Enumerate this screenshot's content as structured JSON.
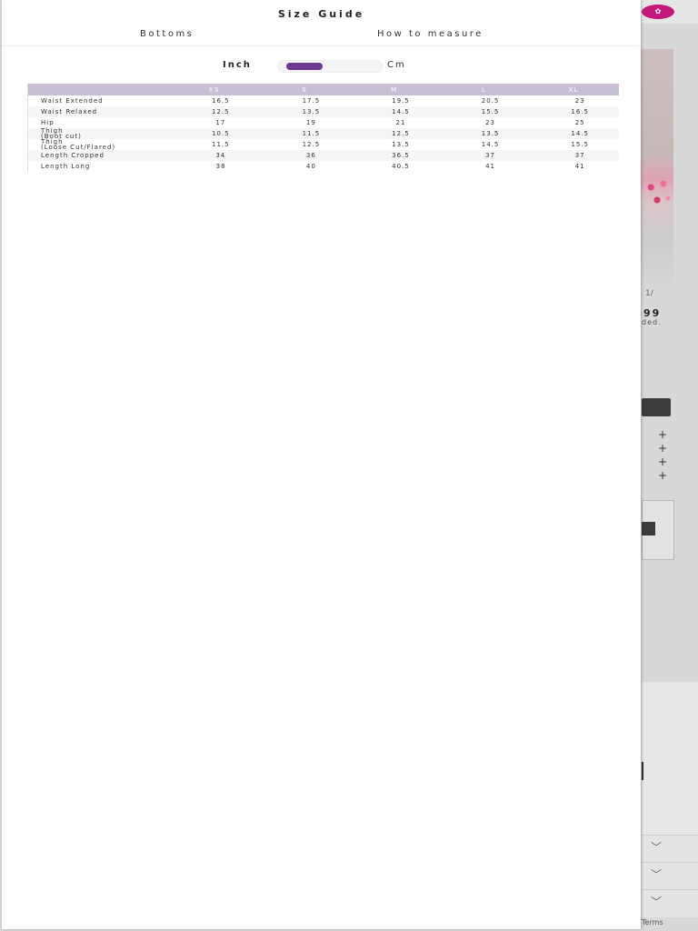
{
  "background": {
    "logo_text": "✿",
    "pager": "1/",
    "price": "99",
    "note": "ded.",
    "terms": "Terms",
    "colors": {
      "brand": "#c2187c",
      "button": "#3c3c3c"
    },
    "accordion_icon": "chevron-down-icon"
  },
  "modal": {
    "title": "Size Guide",
    "tabs": [
      "Bottoms",
      "How to measure"
    ],
    "unit_toggle": {
      "left_label": "Inch",
      "right_label": "Cm",
      "selected": "Inch",
      "accent_color": "#6b3a93"
    },
    "table": {
      "header_color": "#c9bfd4",
      "columns": [
        "",
        "XS",
        "S",
        "M",
        "L",
        "XL"
      ],
      "rows": [
        {
          "label": [
            "Waist Extended"
          ],
          "values": [
            "16.5",
            "17.5",
            "19.5",
            "20.5",
            "23"
          ]
        },
        {
          "label": [
            "Waist Relaxed"
          ],
          "values": [
            "12.5",
            "13.5",
            "14.5",
            "15.5",
            "16.5"
          ]
        },
        {
          "label": [
            "Hip"
          ],
          "values": [
            "17",
            "19",
            "21",
            "23",
            "25"
          ]
        },
        {
          "label": [
            "Thigh",
            "(Boot cut)"
          ],
          "values": [
            "10.5",
            "11.5",
            "12.5",
            "13.5",
            "14.5"
          ]
        },
        {
          "label": [
            "Thigh",
            "(Loose Cut/Flared)"
          ],
          "values": [
            "11.5",
            "12.5",
            "13.5",
            "14.5",
            "15.5"
          ]
        },
        {
          "label": [
            "Length Cropped"
          ],
          "values": [
            "34",
            "36",
            "36.5",
            "37",
            "37"
          ]
        },
        {
          "label": [
            "Length Long"
          ],
          "values": [
            "38",
            "40",
            "40.5",
            "41",
            "41"
          ]
        }
      ]
    }
  }
}
